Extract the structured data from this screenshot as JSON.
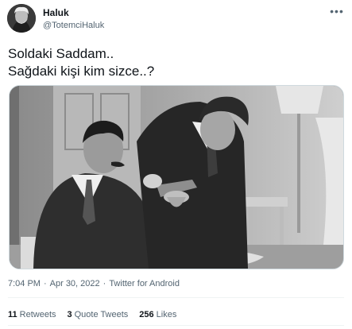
{
  "author": {
    "display_name": "Haluk",
    "handle": "@TotemciHaluk"
  },
  "header": {
    "more_icon": "more-horizontal-icon"
  },
  "tweet": {
    "lines": [
      "Soldaki Saddam..",
      "Sağdaki kişi kim sizce..?"
    ]
  },
  "meta": {
    "time": "7:04 PM",
    "separator": "·",
    "date": "Apr 30, 2022",
    "source": "Twitter for Android"
  },
  "stats": {
    "retweets": {
      "count": "11",
      "label": "Retweets"
    },
    "quote_tweets": {
      "count": "3",
      "label": "Quote Tweets"
    },
    "likes": {
      "count": "256",
      "label": "Likes"
    }
  },
  "colors": {
    "text_primary": "#0f1419",
    "text_secondary": "#536471",
    "border": "#cfd9de"
  }
}
